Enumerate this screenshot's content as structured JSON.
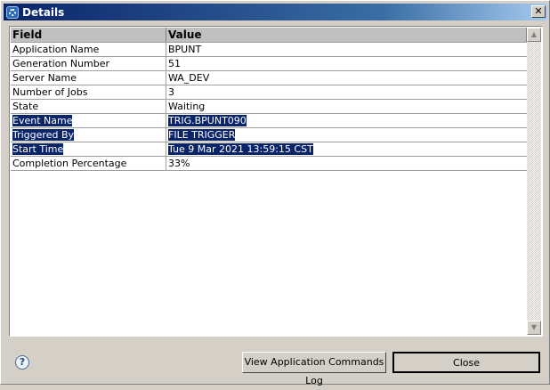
{
  "window": {
    "title": "Details",
    "close_glyph": "✕"
  },
  "table": {
    "headers": [
      "Field",
      "Value"
    ],
    "rows": [
      {
        "field": "Application Name",
        "value": "BPUNT",
        "selected": false
      },
      {
        "field": "Generation Number",
        "value": "51",
        "selected": false
      },
      {
        "field": "Server Name",
        "value": "WA_DEV",
        "selected": false
      },
      {
        "field": "Number of Jobs",
        "value": "3",
        "selected": false
      },
      {
        "field": "State",
        "value": "Waiting",
        "selected": false
      },
      {
        "field": "Event Name",
        "value": "TRIG.BPUNT090",
        "selected": true
      },
      {
        "field": "Triggered By",
        "value": "FILE TRIGGER",
        "selected": true
      },
      {
        "field": "Start Time",
        "value": "Tue 9 Mar 2021 13:59:15 CST",
        "selected": true
      },
      {
        "field": "Completion Percentage",
        "value": "33%",
        "selected": false
      }
    ]
  },
  "footer": {
    "help_glyph": "?",
    "view_log_label": "View Application Commands Log",
    "close_label": "Close"
  }
}
